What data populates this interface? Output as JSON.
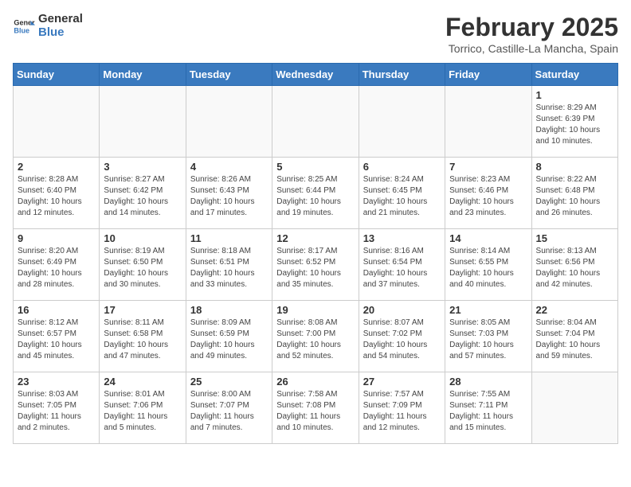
{
  "logo": {
    "text_general": "General",
    "text_blue": "Blue"
  },
  "header": {
    "month_year": "February 2025",
    "location": "Torrico, Castille-La Mancha, Spain"
  },
  "weekdays": [
    "Sunday",
    "Monday",
    "Tuesday",
    "Wednesday",
    "Thursday",
    "Friday",
    "Saturday"
  ],
  "weeks": [
    [
      {
        "day": "",
        "info": ""
      },
      {
        "day": "",
        "info": ""
      },
      {
        "day": "",
        "info": ""
      },
      {
        "day": "",
        "info": ""
      },
      {
        "day": "",
        "info": ""
      },
      {
        "day": "",
        "info": ""
      },
      {
        "day": "1",
        "info": "Sunrise: 8:29 AM\nSunset: 6:39 PM\nDaylight: 10 hours and 10 minutes."
      }
    ],
    [
      {
        "day": "2",
        "info": "Sunrise: 8:28 AM\nSunset: 6:40 PM\nDaylight: 10 hours and 12 minutes."
      },
      {
        "day": "3",
        "info": "Sunrise: 8:27 AM\nSunset: 6:42 PM\nDaylight: 10 hours and 14 minutes."
      },
      {
        "day": "4",
        "info": "Sunrise: 8:26 AM\nSunset: 6:43 PM\nDaylight: 10 hours and 17 minutes."
      },
      {
        "day": "5",
        "info": "Sunrise: 8:25 AM\nSunset: 6:44 PM\nDaylight: 10 hours and 19 minutes."
      },
      {
        "day": "6",
        "info": "Sunrise: 8:24 AM\nSunset: 6:45 PM\nDaylight: 10 hours and 21 minutes."
      },
      {
        "day": "7",
        "info": "Sunrise: 8:23 AM\nSunset: 6:46 PM\nDaylight: 10 hours and 23 minutes."
      },
      {
        "day": "8",
        "info": "Sunrise: 8:22 AM\nSunset: 6:48 PM\nDaylight: 10 hours and 26 minutes."
      }
    ],
    [
      {
        "day": "9",
        "info": "Sunrise: 8:20 AM\nSunset: 6:49 PM\nDaylight: 10 hours and 28 minutes."
      },
      {
        "day": "10",
        "info": "Sunrise: 8:19 AM\nSunset: 6:50 PM\nDaylight: 10 hours and 30 minutes."
      },
      {
        "day": "11",
        "info": "Sunrise: 8:18 AM\nSunset: 6:51 PM\nDaylight: 10 hours and 33 minutes."
      },
      {
        "day": "12",
        "info": "Sunrise: 8:17 AM\nSunset: 6:52 PM\nDaylight: 10 hours and 35 minutes."
      },
      {
        "day": "13",
        "info": "Sunrise: 8:16 AM\nSunset: 6:54 PM\nDaylight: 10 hours and 37 minutes."
      },
      {
        "day": "14",
        "info": "Sunrise: 8:14 AM\nSunset: 6:55 PM\nDaylight: 10 hours and 40 minutes."
      },
      {
        "day": "15",
        "info": "Sunrise: 8:13 AM\nSunset: 6:56 PM\nDaylight: 10 hours and 42 minutes."
      }
    ],
    [
      {
        "day": "16",
        "info": "Sunrise: 8:12 AM\nSunset: 6:57 PM\nDaylight: 10 hours and 45 minutes."
      },
      {
        "day": "17",
        "info": "Sunrise: 8:11 AM\nSunset: 6:58 PM\nDaylight: 10 hours and 47 minutes."
      },
      {
        "day": "18",
        "info": "Sunrise: 8:09 AM\nSunset: 6:59 PM\nDaylight: 10 hours and 49 minutes."
      },
      {
        "day": "19",
        "info": "Sunrise: 8:08 AM\nSunset: 7:00 PM\nDaylight: 10 hours and 52 minutes."
      },
      {
        "day": "20",
        "info": "Sunrise: 8:07 AM\nSunset: 7:02 PM\nDaylight: 10 hours and 54 minutes."
      },
      {
        "day": "21",
        "info": "Sunrise: 8:05 AM\nSunset: 7:03 PM\nDaylight: 10 hours and 57 minutes."
      },
      {
        "day": "22",
        "info": "Sunrise: 8:04 AM\nSunset: 7:04 PM\nDaylight: 10 hours and 59 minutes."
      }
    ],
    [
      {
        "day": "23",
        "info": "Sunrise: 8:03 AM\nSunset: 7:05 PM\nDaylight: 11 hours and 2 minutes."
      },
      {
        "day": "24",
        "info": "Sunrise: 8:01 AM\nSunset: 7:06 PM\nDaylight: 11 hours and 5 minutes."
      },
      {
        "day": "25",
        "info": "Sunrise: 8:00 AM\nSunset: 7:07 PM\nDaylight: 11 hours and 7 minutes."
      },
      {
        "day": "26",
        "info": "Sunrise: 7:58 AM\nSunset: 7:08 PM\nDaylight: 11 hours and 10 minutes."
      },
      {
        "day": "27",
        "info": "Sunrise: 7:57 AM\nSunset: 7:09 PM\nDaylight: 11 hours and 12 minutes."
      },
      {
        "day": "28",
        "info": "Sunrise: 7:55 AM\nSunset: 7:11 PM\nDaylight: 11 hours and 15 minutes."
      },
      {
        "day": "",
        "info": ""
      }
    ]
  ]
}
